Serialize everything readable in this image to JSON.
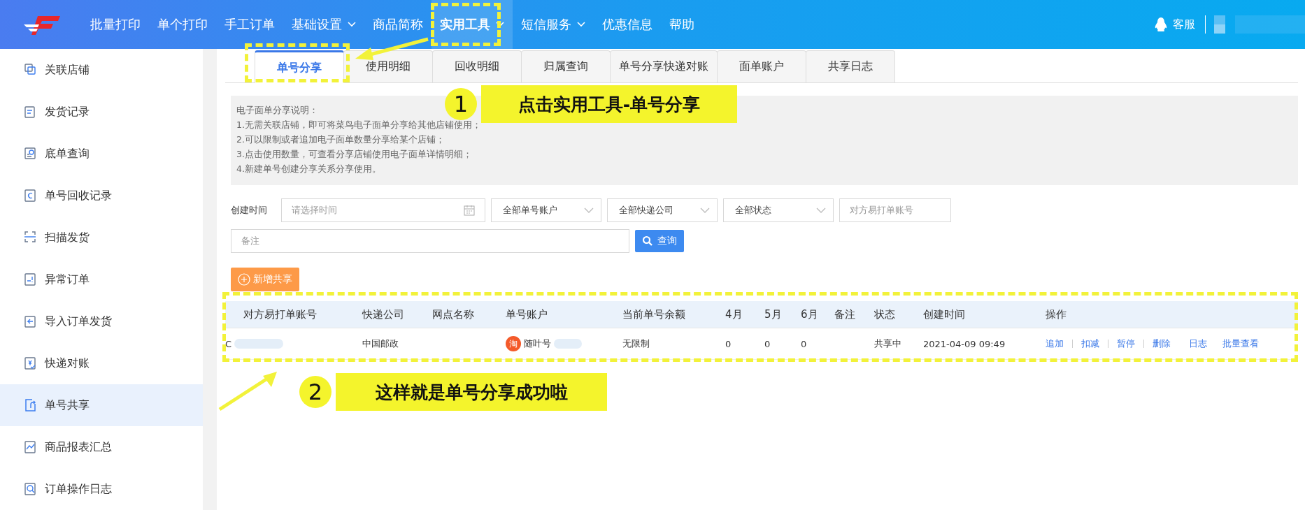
{
  "nav": {
    "items": [
      {
        "label": "批量打印",
        "dropdown": false,
        "selected": false
      },
      {
        "label": "单个打印",
        "dropdown": false,
        "selected": false
      },
      {
        "label": "手工订单",
        "dropdown": false,
        "selected": false
      },
      {
        "label": "基础设置",
        "dropdown": true,
        "selected": false
      },
      {
        "label": "商品简称",
        "dropdown": false,
        "selected": false
      },
      {
        "label": "实用工具",
        "dropdown": true,
        "selected": true
      },
      {
        "label": "短信服务",
        "dropdown": true,
        "selected": false
      },
      {
        "label": "优惠信息",
        "dropdown": false,
        "selected": false
      },
      {
        "label": "帮助",
        "dropdown": false,
        "selected": false
      }
    ],
    "support": "客服"
  },
  "sidebar": {
    "items": [
      {
        "label": "关联店铺",
        "selected": false
      },
      {
        "label": "发货记录",
        "selected": false
      },
      {
        "label": "底单查询",
        "selected": false
      },
      {
        "label": "单号回收记录",
        "selected": false
      },
      {
        "label": "扫描发货",
        "selected": false
      },
      {
        "label": "异常订单",
        "selected": false
      },
      {
        "label": "导入订单发货",
        "selected": false
      },
      {
        "label": "快递对账",
        "selected": false
      },
      {
        "label": "单号共享",
        "selected": true
      },
      {
        "label": "商品报表汇总",
        "selected": false
      },
      {
        "label": "订单操作日志",
        "selected": false
      }
    ]
  },
  "tabs": [
    {
      "label": "单号分享",
      "selected": true
    },
    {
      "label": "使用明细",
      "selected": false
    },
    {
      "label": "回收明细",
      "selected": false
    },
    {
      "label": "归属查询",
      "selected": false
    },
    {
      "label": "单号分享快递对账",
      "selected": false
    },
    {
      "label": "面单账户",
      "selected": false
    },
    {
      "label": "共享日志",
      "selected": false
    }
  ],
  "description": [
    "电子面单分享说明：",
    "1.无需关联店铺，即可将菜鸟电子面单分享给其他店铺使用；",
    "2.可以限制或者追加电子面单数量分享给某个店铺；",
    "3.点击使用数量，可查看分享店铺使用电子面单详情明细；",
    "4.新建单号创建分享关系分享使用。"
  ],
  "filters": {
    "created_label": "创建时间",
    "date_placeholder": "请选择时间",
    "selects": [
      "全部单号账户",
      "全部快递公司",
      "全部状态"
    ],
    "account_placeholder": "对方易打单账号",
    "note_placeholder": "备注",
    "search_button": "查询"
  },
  "add_button": "新增共享",
  "table": {
    "columns": [
      "对方易打单账号",
      "快递公司",
      "网点名称",
      "单号账户",
      "当前单号余额",
      "4月",
      "5月",
      "6月",
      "备注",
      "状态",
      "创建时间",
      "操作"
    ],
    "rows": [
      {
        "account": "C",
        "courier": "中国邮政",
        "account_badge": "淘",
        "waybill_account": "随叶号",
        "balance": "无限制",
        "m4": "0",
        "m5": "0",
        "m6": "0",
        "status": "共享中",
        "created": "2021-04-09 09:49",
        "actions": [
          "追加",
          "扣减",
          "暂停",
          "删除",
          "日志",
          "批量查看"
        ]
      }
    ]
  },
  "annotations": [
    {
      "number": "1",
      "text": "点击实用工具-单号分享"
    },
    {
      "number": "2",
      "text": "这样就是单号分享成功啦"
    }
  ]
}
